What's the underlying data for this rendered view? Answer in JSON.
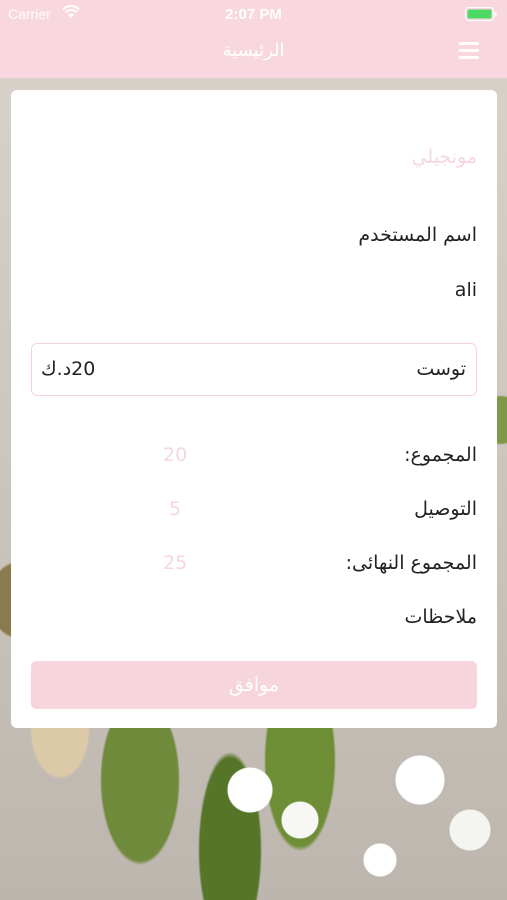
{
  "status_bar": {
    "carrier": "Carrier",
    "time": "2:07 PM"
  },
  "nav": {
    "title": "الرئيسية",
    "menu_icon": "hamburger-menu-icon"
  },
  "dialog": {
    "app_name": "مونجيلي",
    "user_label": "اسم المستخدم",
    "user_value": "ali",
    "item": {
      "name": "توست",
      "price": "20د.ك"
    },
    "totals": [
      {
        "label": "المجموع:",
        "value": "20"
      },
      {
        "label": "التوصيل",
        "value": "5"
      },
      {
        "label": "المجموع النهائى:",
        "value": "25"
      }
    ],
    "notes_label": "ملاحظات",
    "ok_label": "موافق"
  },
  "colors": {
    "accent": "#f8d7df",
    "muted_pink_text": "#f6d7de"
  }
}
